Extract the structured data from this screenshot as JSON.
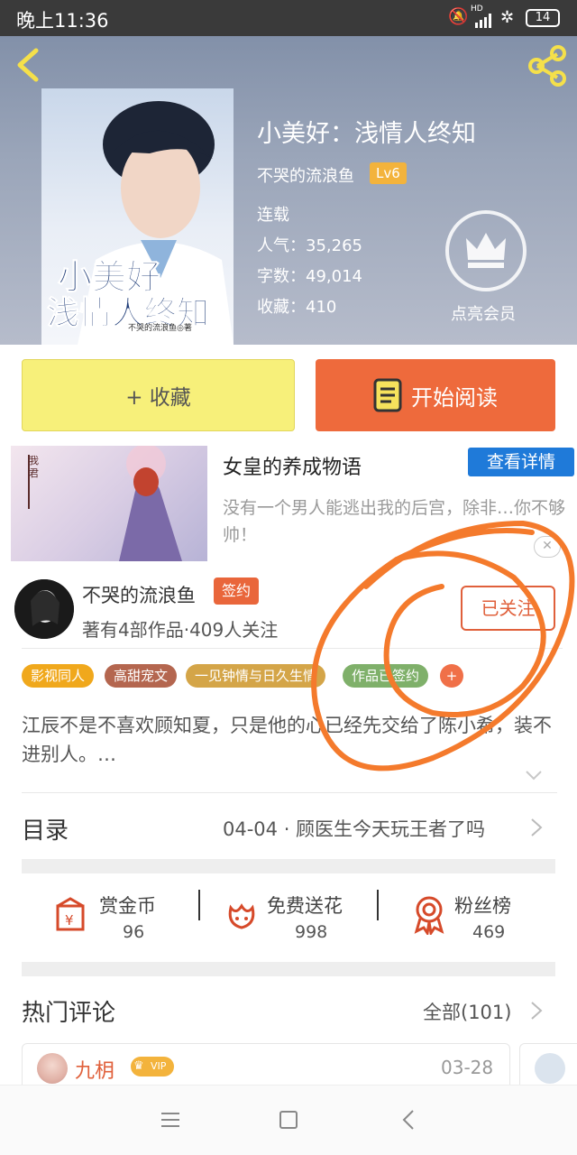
{
  "status_bar": {
    "time": "晚上11:36",
    "net": "HD",
    "battery": "14"
  },
  "book": {
    "title": "小美好：浅情人终知",
    "author": "不哭的流浪鱼",
    "level": "Lv6",
    "status": "连载",
    "popularity": "人气：35,265",
    "words": "字数：49,014",
    "favorites": "收藏：410",
    "cover_title_line1": "小美好",
    "cover_title_line2": "浅情人终知",
    "cover_author": "不哭的流浪鱼◎著"
  },
  "membership": {
    "label": "点亮会员"
  },
  "actions": {
    "favorite": "+ 收藏",
    "read": "开始阅读"
  },
  "ad": {
    "title": "女皇的养成物语",
    "detail_button": "查看详情",
    "description": "没有一个男人能逃出我的后宫，除非…你不够帅！"
  },
  "author_card": {
    "name": "不哭的流浪鱼",
    "badge": "签约",
    "stats": "著有4部作品·409人关注",
    "follow_button": "已关注"
  },
  "tags": [
    {
      "label": "影视同人",
      "color": "#f0a81c"
    },
    {
      "label": "高甜宠文",
      "color": "#b4664f"
    },
    {
      "label": "一见钟情与日久生情",
      "color": "#d4a548"
    },
    {
      "label": "作品已签约",
      "color": "#7fb06a"
    },
    {
      "label": "+",
      "color": "#f07048"
    }
  ],
  "synopsis": "江辰不是不喜欢顾知夏，只是他的心已经先交给了陈小希，装不进别人。…",
  "toc": {
    "label": "目录",
    "latest": "04-04 · 顾医生今天玩王者了吗"
  },
  "stats_row": [
    {
      "label": "赏金币",
      "value": "96",
      "icon": "reward-coin-icon"
    },
    {
      "label": "免费送花",
      "value": "998",
      "icon": "flower-icon"
    },
    {
      "label": "粉丝榜",
      "value": "469",
      "icon": "fan-ribbon-icon"
    }
  ],
  "comments": {
    "heading": "热门评论",
    "all_label": "全部(101)",
    "first": {
      "user": "九枂",
      "vip": "VIP",
      "date": "03-28"
    }
  },
  "colors": {
    "accent": "#ee6a3c",
    "annotation": "#f47a2c",
    "link_blue": "#1f7ad9"
  }
}
